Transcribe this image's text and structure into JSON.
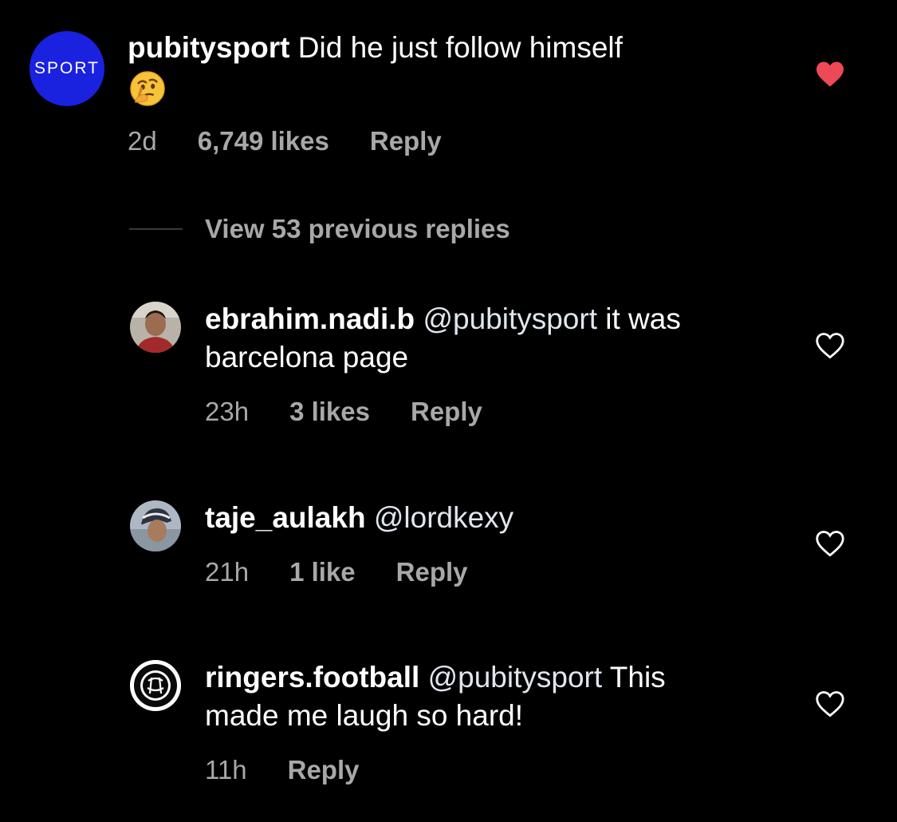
{
  "colors": {
    "background": "#000000",
    "text_primary": "#ffffff",
    "text_secondary": "#a8a8a8",
    "liked_heart": "#ed4956",
    "brand_avatar": "#1a22e0"
  },
  "main_comment": {
    "avatar_text": "SPORT",
    "username": "pubitysport",
    "text": "Did he just follow himself",
    "emoji": "thinking-face",
    "time": "2d",
    "likes": "6,749 likes",
    "reply_label": "Reply",
    "liked": true
  },
  "view_previous": "View 53 previous replies",
  "replies": [
    {
      "username": "ebrahim.nadi.b",
      "mention": "@pubitysport",
      "text_line1": " it was",
      "text_line2": "barcelona page",
      "time": "23h",
      "likes": "3 likes",
      "reply_label": "Reply",
      "liked": false
    },
    {
      "username": "taje_aulakh",
      "mention": "@lordkexy",
      "text_line1": "",
      "time": "21h",
      "likes": "1 like",
      "reply_label": "Reply",
      "liked": false
    },
    {
      "username": "ringers.football",
      "mention": "@pubitysport",
      "text_line1": " This",
      "text_line2": "made me laugh so hard!",
      "time": "11h",
      "reply_label": "Reply",
      "liked": false
    }
  ]
}
